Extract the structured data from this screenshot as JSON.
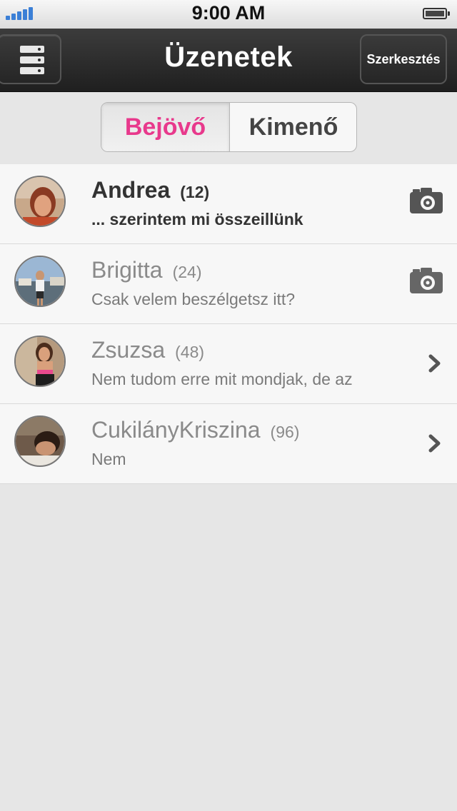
{
  "status_bar": {
    "time": "9:00 AM",
    "signal_icon": "signal-bars-icon",
    "battery_icon": "battery-icon"
  },
  "nav": {
    "title": "Üzenetek",
    "menu_icon": "server-menu-icon",
    "edit_label": "Szerkesztés"
  },
  "segments": {
    "inbox_label": "Bejövő",
    "outbox_label": "Kimenő",
    "selected": "inbox"
  },
  "colors": {
    "accent": "#e8398c",
    "nav_bg": "#2a2a2a"
  },
  "conversations": [
    {
      "name": "Andrea",
      "count": "(12)",
      "preview": "... szerintem mi összeillünk",
      "unread": true,
      "trailing_icon": "camera-icon"
    },
    {
      "name": "Brigitta",
      "count": "(24)",
      "preview": "Csak velem beszélgetsz itt?",
      "unread": false,
      "trailing_icon": "camera-icon"
    },
    {
      "name": "Zsuzsa",
      "count": "(48)",
      "preview": "Nem tudom erre mit mondjak, de az",
      "unread": false,
      "trailing_icon": "chevron-right-icon"
    },
    {
      "name": "CukilányKriszina",
      "count": "(96)",
      "preview": "Nem",
      "unread": false,
      "trailing_icon": "chevron-right-icon"
    }
  ]
}
